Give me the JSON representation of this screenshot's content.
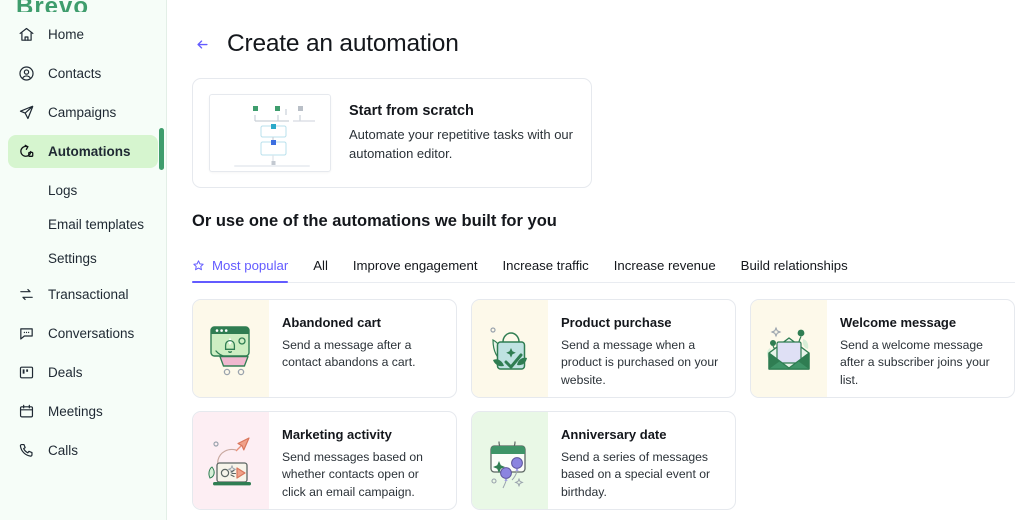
{
  "brand": {
    "name": "Brevo"
  },
  "sidebar": {
    "items": [
      {
        "label": "Home",
        "icon": "home-icon",
        "active": false
      },
      {
        "label": "Contacts",
        "icon": "contacts-icon",
        "active": false
      },
      {
        "label": "Campaigns",
        "icon": "campaigns-icon",
        "active": false
      },
      {
        "label": "Automations",
        "icon": "automations-icon",
        "active": true
      }
    ],
    "sub_items": [
      {
        "label": "Logs"
      },
      {
        "label": "Email templates"
      },
      {
        "label": "Settings"
      }
    ],
    "items_after": [
      {
        "label": "Transactional",
        "icon": "transactional-icon"
      },
      {
        "label": "Conversations",
        "icon": "conversations-icon"
      },
      {
        "label": "Deals",
        "icon": "deals-icon"
      },
      {
        "label": "Meetings",
        "icon": "meetings-icon"
      },
      {
        "label": "Calls",
        "icon": "calls-icon"
      }
    ],
    "accent_color": "#d6f5cf",
    "scrollbar_color": "#3f9d6d",
    "background": "#f6fdf8"
  },
  "header": {
    "back_icon": "arrow-left-icon",
    "title": "Create an automation"
  },
  "scratch": {
    "title": "Start from scratch",
    "description": "Automate your repetitive tasks with our automation editor.",
    "thumbnail_icon": "flowchart-thumbnail"
  },
  "section": {
    "heading": "Or use one of the automations we built for you"
  },
  "tabs": {
    "active_color": "#635bff",
    "items": [
      {
        "label": "Most popular",
        "icon": "star-icon",
        "active": true
      },
      {
        "label": "All",
        "active": false
      },
      {
        "label": "Improve engagement",
        "active": false
      },
      {
        "label": "Increase traffic",
        "active": false
      },
      {
        "label": "Increase revenue",
        "active": false
      },
      {
        "label": "Build relationships",
        "active": false
      }
    ]
  },
  "cards": [
    {
      "title": "Abandoned cart",
      "description": "Send a message after a contact abandons a cart.",
      "art_icon": "abandoned-cart-illustration",
      "art_bg": "#fdf9ea"
    },
    {
      "title": "Product purchase",
      "description": "Send a message when a product is purchased on your website.",
      "art_icon": "product-purchase-illustration",
      "art_bg": "#fdf9ea"
    },
    {
      "title": "Welcome message",
      "description": "Send a welcome message after a subscriber joins your list.",
      "art_icon": "welcome-message-illustration",
      "art_bg": "#fdf9ea"
    },
    {
      "title": "Marketing activity",
      "description": "Send messages based on whether contacts open or click an email campaign.",
      "art_icon": "marketing-activity-illustration",
      "art_bg": "#fdeef3"
    },
    {
      "title": "Anniversary date",
      "description": "Send a series of messages based on a special event or birthday.",
      "art_icon": "anniversary-date-illustration",
      "art_bg": "#e9f8e6"
    }
  ]
}
